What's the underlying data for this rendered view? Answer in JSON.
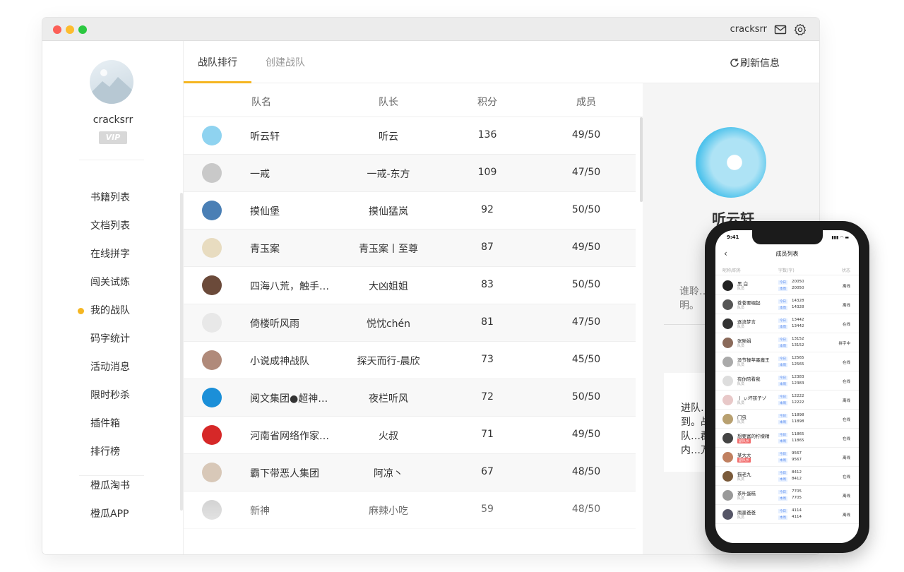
{
  "window": {
    "username": "cracksrr",
    "icons": {
      "mail": "mail-icon",
      "settings": "gear-icon"
    }
  },
  "sidebar": {
    "username": "cracksrr",
    "vip": "VIP",
    "items": [
      {
        "label": "书籍列表"
      },
      {
        "label": "文档列表"
      },
      {
        "label": "在线拼字"
      },
      {
        "label": "闯关试炼"
      },
      {
        "label": "我的战队",
        "active": true
      },
      {
        "label": "码字统计"
      },
      {
        "label": "活动消息"
      },
      {
        "label": "限时秒杀"
      },
      {
        "label": "插件箱"
      },
      {
        "label": "排行榜"
      }
    ],
    "extra_items": [
      {
        "label": "橙瓜淘书"
      },
      {
        "label": "橙瓜APP"
      }
    ]
  },
  "tabs": [
    {
      "label": "战队排行",
      "active": true
    },
    {
      "label": "创建战队",
      "active": false
    }
  ],
  "refresh_label": "刷新信息",
  "table": {
    "headers": [
      "队名",
      "队长",
      "积分",
      "成员"
    ],
    "rows": [
      {
        "name": "听云轩",
        "captain": "听云",
        "points": "136",
        "members": "49/50"
      },
      {
        "name": "一戒",
        "captain": "一戒-东方",
        "points": "109",
        "members": "47/50"
      },
      {
        "name": "摸仙堡",
        "captain": "摸仙猛岚",
        "points": "92",
        "members": "50/50"
      },
      {
        "name": "青玉案",
        "captain": "青玉案丨至尊",
        "points": "87",
        "members": "49/50"
      },
      {
        "name": "四海八荒，触手…",
        "captain": "大凶姐姐",
        "points": "83",
        "members": "50/50"
      },
      {
        "name": "倚楼听风雨",
        "captain": "悦忱chén",
        "points": "81",
        "members": "47/50"
      },
      {
        "name": "小说成神战队",
        "captain": "探天而行-晨欣",
        "points": "73",
        "members": "45/50"
      },
      {
        "name": "阅文集团●超神…",
        "captain": "夜栏听风",
        "points": "72",
        "members": "50/50"
      },
      {
        "name": "河南省网络作家…",
        "captain": "火叔",
        "points": "71",
        "members": "49/50"
      },
      {
        "name": "霸下带恶人集团",
        "captain": "阿凉丶",
        "points": "67",
        "members": "48/50"
      },
      {
        "name": "新神",
        "captain": "麻辣小吃",
        "points": "59",
        "members": "48/50"
      }
    ]
  },
  "detail": {
    "team_name": "听云轩",
    "desc": "谁聆…明。",
    "notice": "进队…到。战队…群内…万，"
  },
  "phone": {
    "time": "9:41",
    "title": "成员列表",
    "headers": [
      "昵称/职务",
      "字数(字)",
      "状态"
    ],
    "label_today": "今日",
    "label_week": "本周",
    "members": [
      {
        "name": "黑 白",
        "role": "队员",
        "today": "20050",
        "week": "20050",
        "state": "离线"
      },
      {
        "name": "苍苍要崛起",
        "role": "队员",
        "today": "14328",
        "week": "14328",
        "state": "离线"
      },
      {
        "name": "逐浪梦言",
        "role": "队员",
        "today": "13442",
        "week": "13442",
        "state": "在线"
      },
      {
        "name": "张晰娟",
        "role": "队员",
        "today": "13152",
        "week": "13152",
        "state": "拼字中"
      },
      {
        "name": "没节操苹墨魔王",
        "role": "队员",
        "today": "12565",
        "week": "12565",
        "state": "在线"
      },
      {
        "name": "有你陪看我",
        "role": "队员",
        "today": "12383",
        "week": "12383",
        "state": "在线"
      },
      {
        "name": "丨 ぃ坏孩子ゾ",
        "role": "队员",
        "today": "12222",
        "week": "12222",
        "state": "离线"
      },
      {
        "name": "门虫",
        "role": "队员",
        "today": "11898",
        "week": "11898",
        "state": "在线"
      },
      {
        "name": "想要富的柠檬精",
        "role": "副队长",
        "today": "11865",
        "week": "11865",
        "state": "在线"
      },
      {
        "name": "某大大",
        "role": "副队长",
        "today": "9567",
        "week": "9567",
        "state": "离线"
      },
      {
        "name": "猫老九",
        "role": "队员",
        "today": "8412",
        "week": "8412",
        "state": "在线"
      },
      {
        "name": "茶叶蛋糕",
        "role": "队员",
        "today": "7705",
        "week": "7705",
        "state": "离线"
      },
      {
        "name": "雨墨爸爸",
        "role": "队员",
        "today": "4114",
        "week": "4114",
        "state": "离线"
      }
    ]
  }
}
